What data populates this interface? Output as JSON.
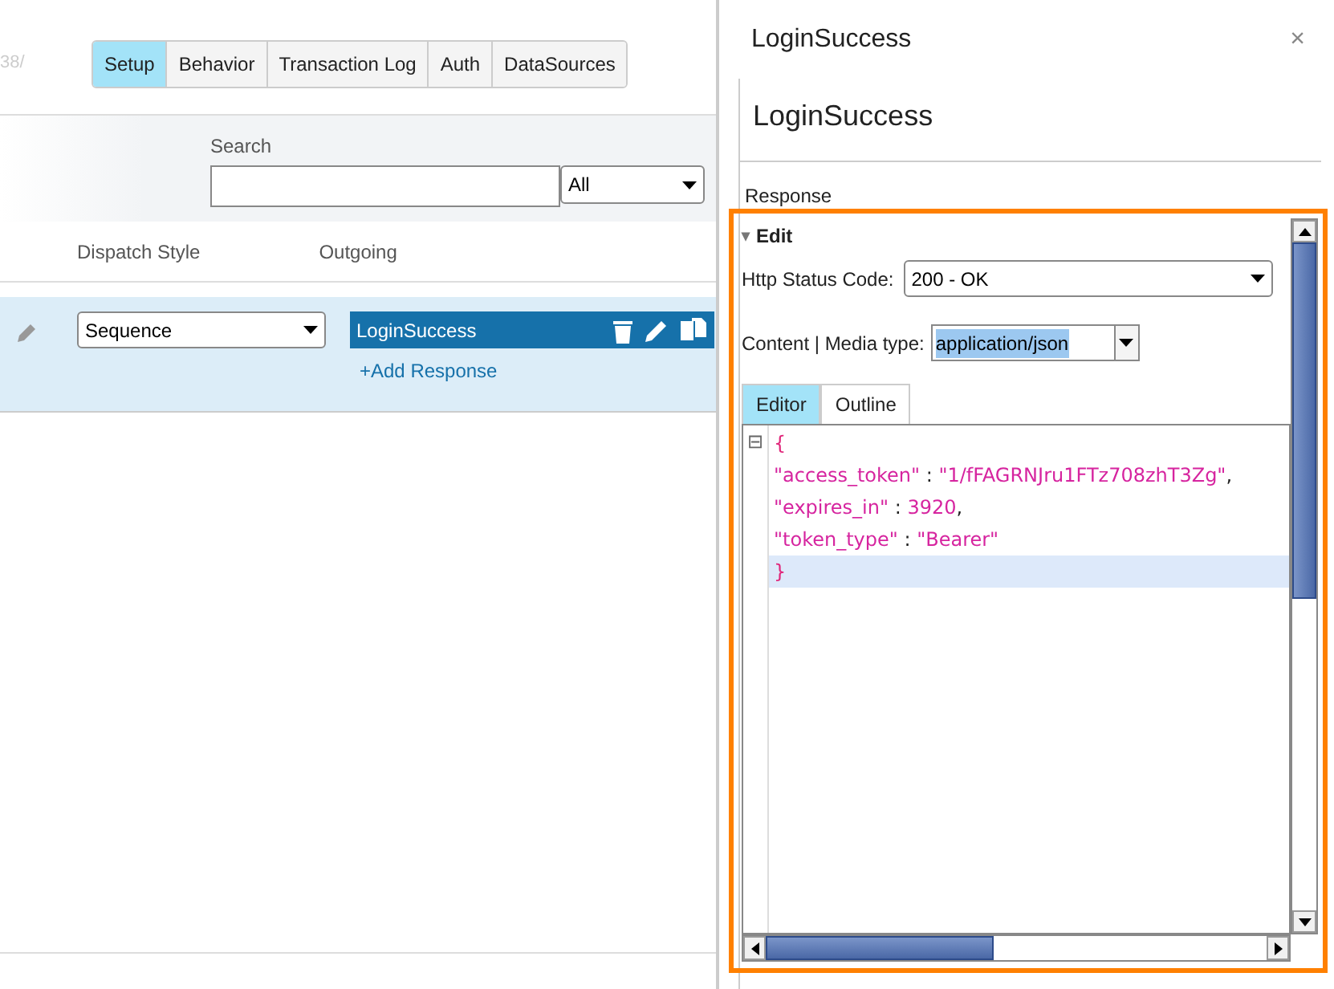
{
  "left_pane": {
    "path_fragment": "38/",
    "tabs": [
      {
        "label": "Setup",
        "selected": true
      },
      {
        "label": "Behavior",
        "selected": false
      },
      {
        "label": "Transaction Log",
        "selected": false
      },
      {
        "label": "Auth",
        "selected": false
      },
      {
        "label": "DataSources",
        "selected": false
      }
    ],
    "search": {
      "label": "Search",
      "filter": "All"
    },
    "columns": [
      "Dispatch Style",
      "Outgoing"
    ],
    "rows": [
      {
        "selected": true,
        "dispatch_style": "Sequence",
        "outgoing": "LoginSuccess",
        "add_link": "+Add Response"
      }
    ]
  },
  "panel": {
    "title": "LoginSuccess",
    "close": "×",
    "heading": "LoginSuccess",
    "section_label": "Response",
    "edit": {
      "label": "Edit",
      "expanded": true,
      "toggle": "▾",
      "status_code": {
        "label": "Http Status Code:",
        "value": "200 - OK"
      },
      "media_type": {
        "label": "Content | Media type:",
        "value": "application/json"
      },
      "tabs": [
        {
          "label": "Editor",
          "selected": true
        },
        {
          "label": "Outline",
          "selected": false
        }
      ],
      "fold": "⊟",
      "code_lines": [
        {
          "current": false,
          "tokens": [
            {
              "kind": "brace",
              "text": "{"
            }
          ]
        },
        {
          "current": false,
          "tokens": [
            {
              "kind": "key",
              "text": "\"access_token\""
            },
            {
              "kind": "punct",
              "text": " : "
            },
            {
              "kind": "string",
              "text": "\"1/fFAGRNJru1FTz708zhT3Zg\""
            },
            {
              "kind": "punct",
              "text": ","
            }
          ]
        },
        {
          "current": false,
          "tokens": [
            {
              "kind": "key",
              "text": "\"expires_in\""
            },
            {
              "kind": "punct",
              "text": " : "
            },
            {
              "kind": "number",
              "text": "3920"
            },
            {
              "kind": "punct",
              "text": ","
            }
          ]
        },
        {
          "current": false,
          "tokens": [
            {
              "kind": "key",
              "text": "\"token_type\""
            },
            {
              "kind": "punct",
              "text": " : "
            },
            {
              "kind": "string",
              "text": "\"Bearer\""
            }
          ]
        },
        {
          "current": true,
          "tokens": [
            {
              "kind": "brace",
              "text": "}"
            }
          ]
        }
      ]
    }
  }
}
